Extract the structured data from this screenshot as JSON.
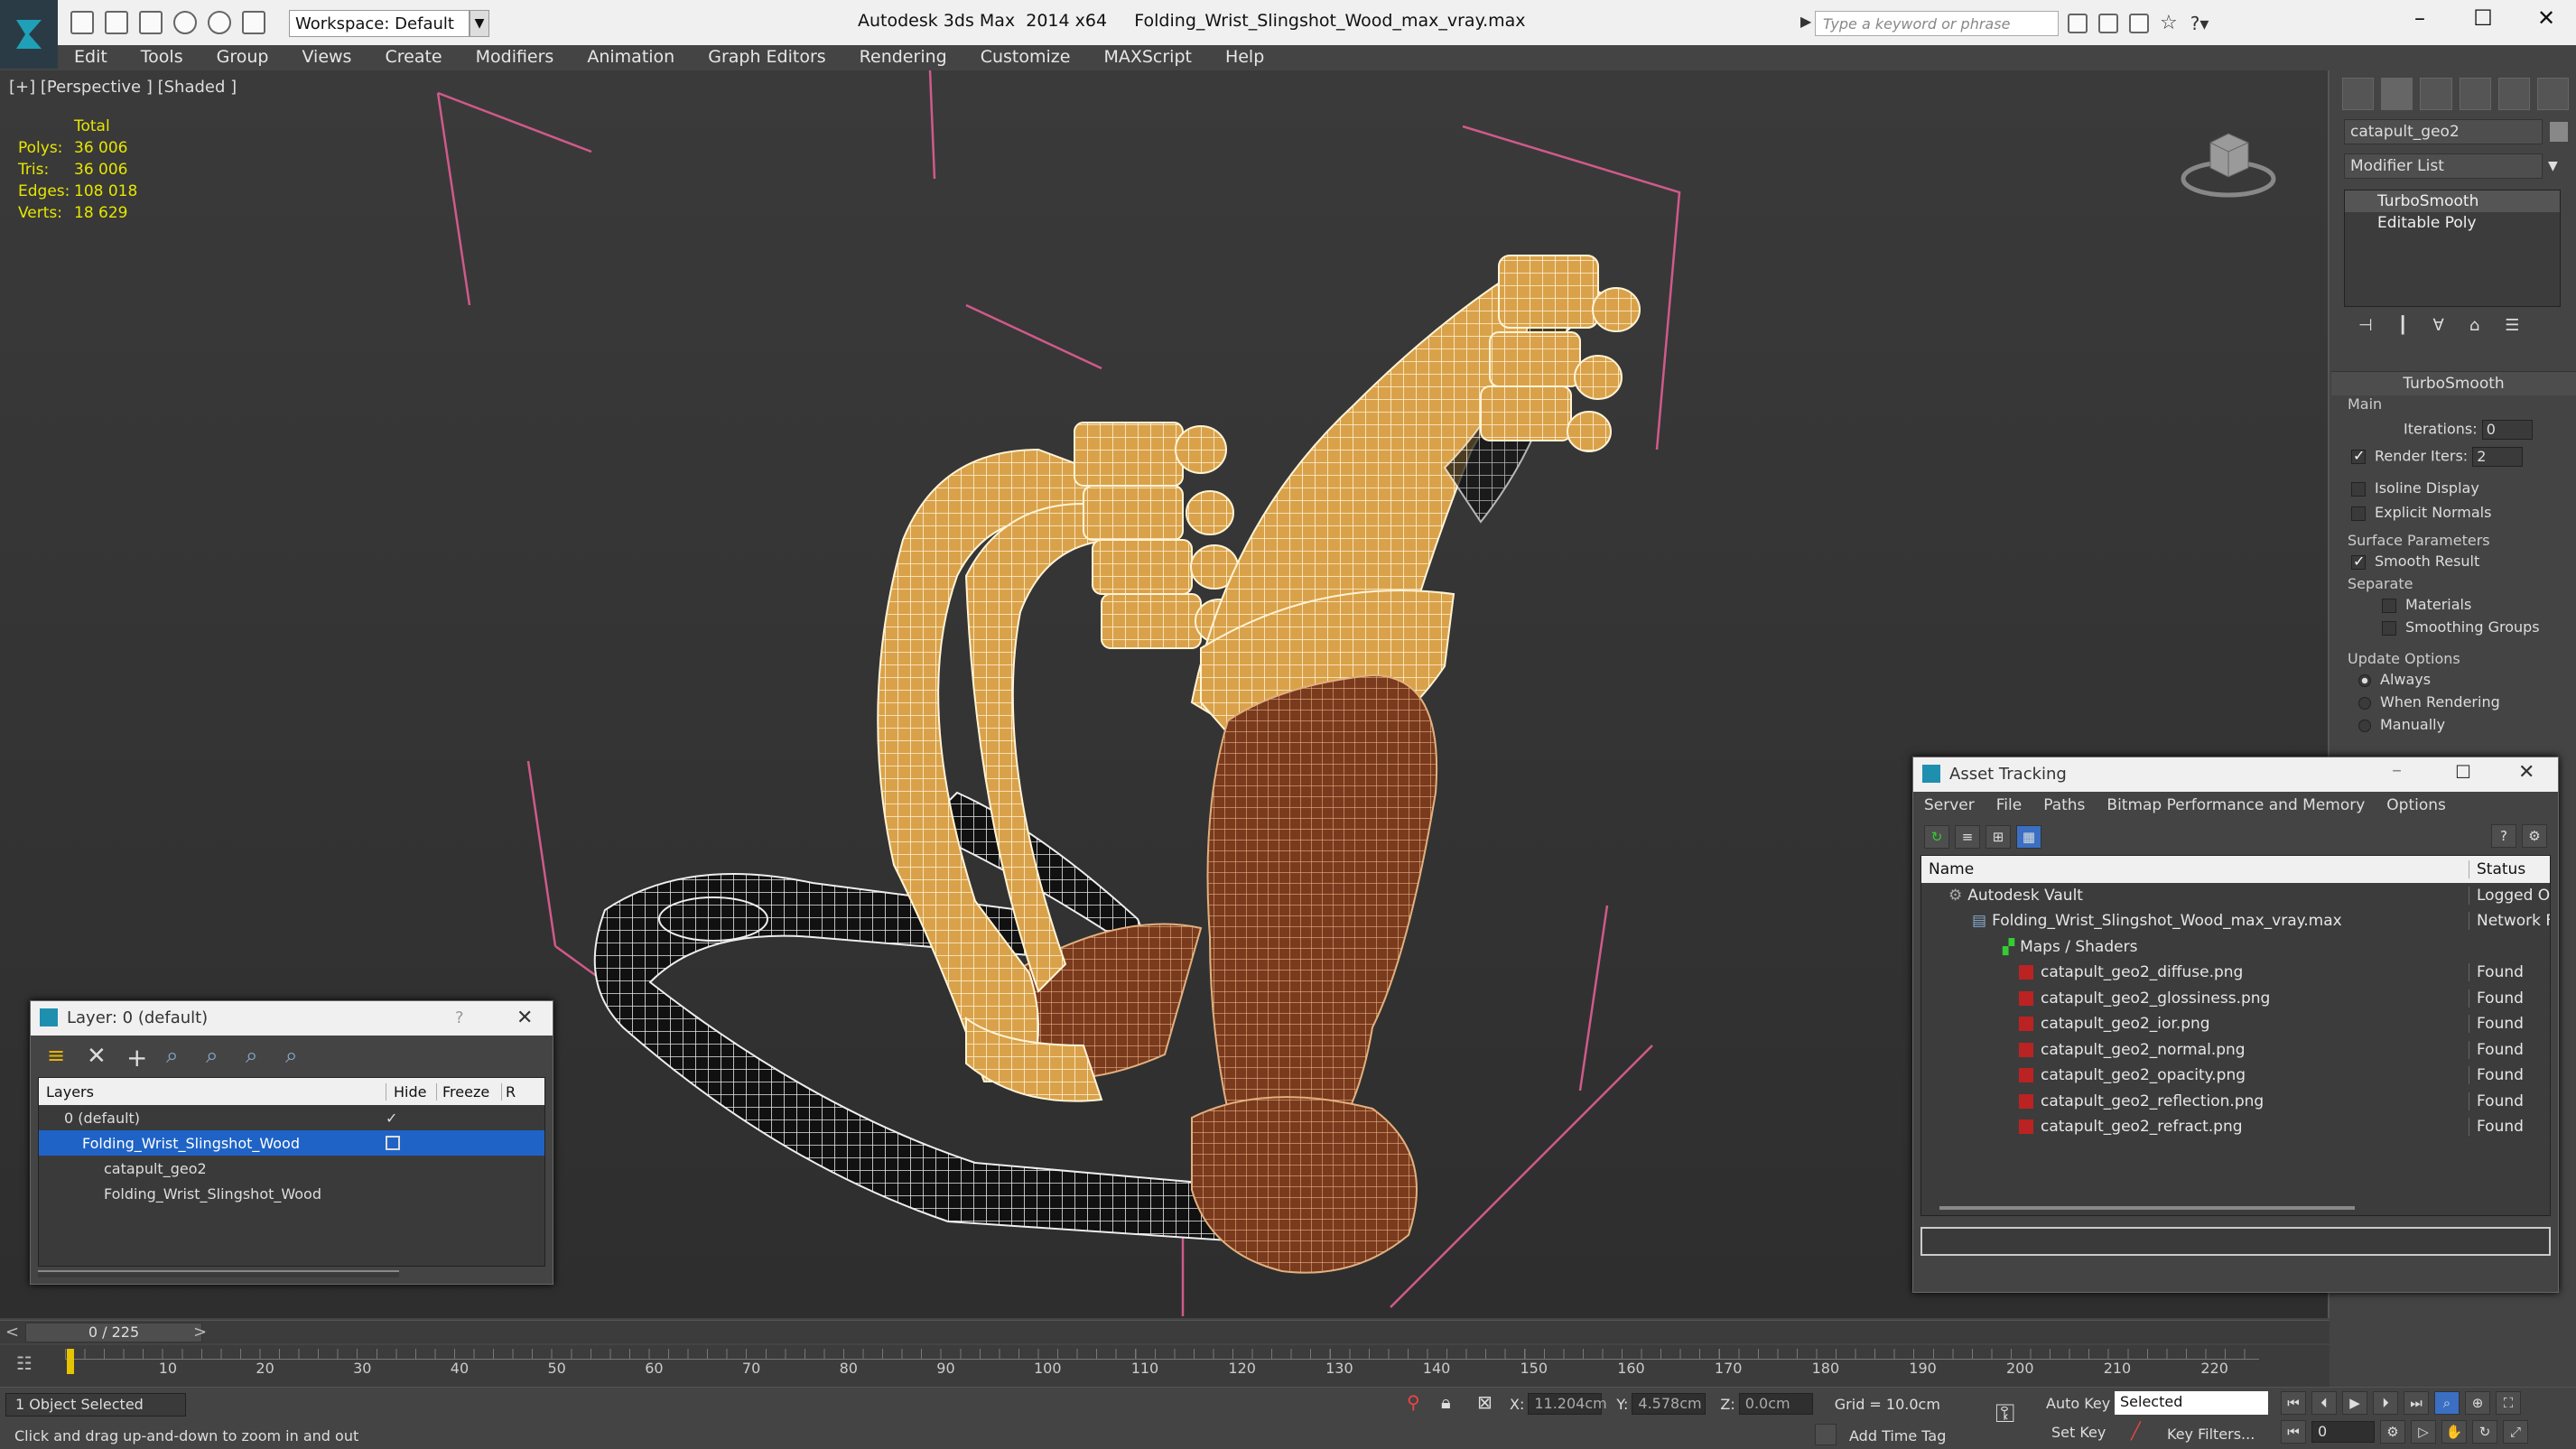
{
  "titlebar": {
    "workspace": "Workspace: Default",
    "app_title": "Autodesk 3ds Max  2014 x64",
    "file_name": "Folding_Wrist_Slingshot_Wood_max_vray.max",
    "search_placeholder": "Type a keyword or phrase"
  },
  "menu": [
    "Edit",
    "Tools",
    "Group",
    "Views",
    "Create",
    "Modifiers",
    "Animation",
    "Graph Editors",
    "Rendering",
    "Customize",
    "MAXScript",
    "Help"
  ],
  "viewport": {
    "label": "[+] [Perspective ] [Shaded ]",
    "stats": {
      "header": "Total",
      "polys_label": "Polys:",
      "polys": "36 006",
      "tris_label": "Tris:",
      "tris": "36 006",
      "edges_label": "Edges:",
      "edges": "108 018",
      "verts_label": "Verts:",
      "verts": "18 629"
    }
  },
  "command_panel": {
    "object_name": "catapult_geo2",
    "modifier_list": "Modifier List",
    "stack": [
      "TurboSmooth",
      "Editable Poly"
    ],
    "rollout_title": "TurboSmooth",
    "main_label": "Main",
    "iterations_label": "Iterations:",
    "iterations_value": "0",
    "render_iters_label": "Render Iters:",
    "render_iters_value": "2",
    "isoline_label": "Isoline Display",
    "explicit_normals_label": "Explicit Normals",
    "surface_params_label": "Surface Parameters",
    "smooth_result_label": "Smooth Result",
    "separate_label": "Separate",
    "materials_label": "Materials",
    "smoothing_groups_label": "Smoothing Groups",
    "update_options_label": "Update Options",
    "always_label": "Always",
    "when_rendering_label": "When Rendering",
    "manually_label": "Manually"
  },
  "layer_dialog": {
    "title": "Layer: 0 (default)",
    "help": "?",
    "col_layers": "Layers",
    "col_hide": "Hide",
    "col_freeze": "Freeze",
    "col_r": "R",
    "rows": [
      {
        "name": "0 (default)"
      },
      {
        "name": "Folding_Wrist_Slingshot_Wood"
      },
      {
        "name": "catapult_geo2"
      },
      {
        "name": "Folding_Wrist_Slingshot_Wood"
      }
    ]
  },
  "asset_dialog": {
    "title": "Asset Tracking",
    "menu": [
      "Server",
      "File",
      "Paths",
      "Bitmap Performance and Memory",
      "Options"
    ],
    "col_name": "Name",
    "col_status": "Status",
    "rows": [
      {
        "name": "Autodesk Vault",
        "status": "Logged O"
      },
      {
        "name": "Folding_Wrist_Slingshot_Wood_max_vray.max",
        "status": "Network F"
      },
      {
        "name": "Maps / Shaders",
        "status": ""
      },
      {
        "name": "catapult_geo2_diffuse.png",
        "status": "Found"
      },
      {
        "name": "catapult_geo2_glossiness.png",
        "status": "Found"
      },
      {
        "name": "catapult_geo2_ior.png",
        "status": "Found"
      },
      {
        "name": "catapult_geo2_normal.png",
        "status": "Found"
      },
      {
        "name": "catapult_geo2_opacity.png",
        "status": "Found"
      },
      {
        "name": "catapult_geo2_reflection.png",
        "status": "Found"
      },
      {
        "name": "catapult_geo2_refract.png",
        "status": "Found"
      }
    ]
  },
  "timeline": {
    "frame": "0 / 225",
    "ticks": [
      "10",
      "20",
      "30",
      "40",
      "50",
      "60",
      "70",
      "80",
      "90",
      "100",
      "110",
      "120",
      "130",
      "140",
      "150",
      "160",
      "170",
      "180",
      "190",
      "200",
      "210",
      "220"
    ]
  },
  "status": {
    "selection": "1 Object Selected",
    "prompt": "Click and drag up-and-down to zoom in and out",
    "x_label": "X:",
    "x_value": "11.204cm",
    "y_label": "Y:",
    "y_value": "4.578cm",
    "z_label": "Z:",
    "z_value": "0.0cm",
    "grid": "Grid = 10.0cm",
    "add_time_tag": "Add Time Tag",
    "auto_key": "Auto Key",
    "set_key": "Set Key",
    "selected": "Selected",
    "key_filters": "Key Filters...",
    "frame_value": "0"
  },
  "colors": {
    "selection_blue": "#1f63c6",
    "wire_gold": "#d9a24a",
    "grip_brown": "#7a3a1e",
    "bbox_pink": "#d05a8a",
    "stat_yellow": "#e6e600"
  }
}
